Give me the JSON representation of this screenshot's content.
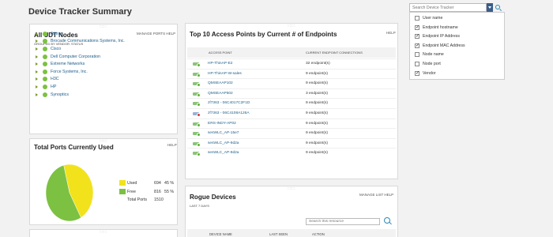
{
  "page": {
    "title": "Device Tracker Summary"
  },
  "udt": {
    "title": "All UDT Nodes",
    "links": "MANAGE PORTS  HELP",
    "subtitle": "GROUPED BY VENDOR: STATUS",
    "vendors": [
      "Adtran",
      "Brocade Communications Systems, Inc.",
      "Cisco",
      "Dell Computer Corporation",
      "Extreme Networks",
      "Force Systems, Inc.",
      "H3C",
      "HP",
      "Synoptics"
    ],
    "status_color": "#7cc142"
  },
  "ports": {
    "title": "Total Ports Currently Used",
    "help": "HELP",
    "legend": [
      {
        "label": "Used",
        "count": "694",
        "pct": "45 %",
        "color": "#f2e21c"
      },
      {
        "label": "Free",
        "count": "816",
        "pct": "55 %",
        "color": "#7cc142"
      }
    ],
    "total_label": "Total Ports",
    "total_value": "1510"
  },
  "ap": {
    "title": "Top 10 Access Points by Current # of Endpoints",
    "help": "HELP",
    "col_ap": "ACCESS POINT",
    "col_conn": "CURRENT ENDPOINT CONNECTIONS",
    "rows": [
      {
        "name": "HP-ThinAP-E2",
        "count": "32 endpoint(s)",
        "status": "up"
      },
      {
        "name": "HP-ThinAP-W-sales",
        "count": "9 endpoint(s)",
        "status": "up"
      },
      {
        "name": "QMSEAAP102",
        "count": "9 endpoint(s)",
        "status": "up"
      },
      {
        "name": "QMSEAAP502",
        "count": "3 endpoint(s)",
        "status": "up"
      },
      {
        "name": "zf7363 - 06C4017C2F1D",
        "count": "9 endpoint(s)",
        "status": "up"
      },
      {
        "name": "zf7363 - 06C4108A126A",
        "count": "9 endpoint(s)",
        "status": "down"
      },
      {
        "name": "ERS-INDY-AP02",
        "count": "9 endpoint(s)",
        "status": "up"
      },
      {
        "name": "sesWLC_AP-15e7",
        "count": "9 endpoint(s)",
        "status": "up"
      },
      {
        "name": "sesWLC_AP-9d2a",
        "count": "9 endpoint(s)",
        "status": "up"
      },
      {
        "name": "sesWLC_AP-9d2a",
        "count": "9 endpoint(s)",
        "status": "up"
      }
    ]
  },
  "rogue": {
    "title": "Rogue Devices",
    "links": "MANAGE LIST  HELP",
    "subtitle": "LAST 7 DAYS",
    "search_placeholder": "Search this resource",
    "col_device": "DEVICE NAME",
    "col_seen": "LAST SEEN",
    "col_action": "ACTION"
  },
  "search": {
    "placeholder": "Search Device Tracker",
    "options": [
      {
        "label": "User name",
        "checked": false
      },
      {
        "label": "Endpoint hostname",
        "checked": true
      },
      {
        "label": "Endpoint IP Address",
        "checked": true
      },
      {
        "label": "Endpoint MAC Address",
        "checked": true
      },
      {
        "label": "Node name",
        "checked": false
      },
      {
        "label": "Node port",
        "checked": false
      },
      {
        "label": "Vendor",
        "checked": true
      }
    ]
  },
  "colors": {
    "accent": "#3a5d8c",
    "link": "#1a5d8c",
    "alert": "#d83a2b"
  }
}
